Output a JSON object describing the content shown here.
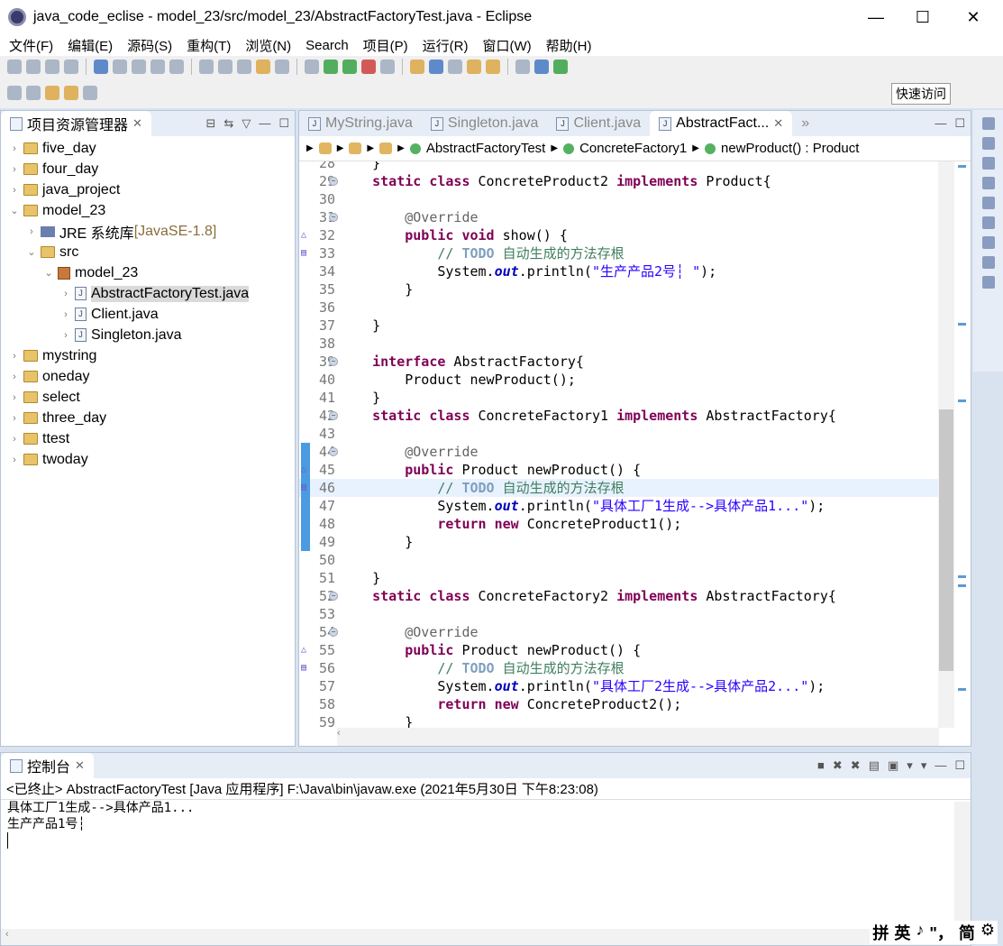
{
  "window": {
    "title": "java_code_eclise - model_23/src/model_23/AbstractFactoryTest.java - Eclipse",
    "minimize": "—",
    "maximize": "☐",
    "close": "✕"
  },
  "menu": [
    "文件(F)",
    "编辑(E)",
    "源码(S)",
    "重构(T)",
    "浏览(N)",
    "Search",
    "项目(P)",
    "运行(R)",
    "窗口(W)",
    "帮助(H)"
  ],
  "quick_access": "快速访问",
  "explorer": {
    "title": "项目资源管理器",
    "items": [
      {
        "label": "five_day",
        "depth": 0,
        "arrow": "›",
        "icon": "folder"
      },
      {
        "label": "four_day",
        "depth": 0,
        "arrow": "›",
        "icon": "folder"
      },
      {
        "label": "java_project",
        "depth": 0,
        "arrow": "›",
        "icon": "folder"
      },
      {
        "label": "model_23",
        "depth": 0,
        "arrow": "⌄",
        "icon": "folder"
      },
      {
        "label": "JRE 系统库",
        "extra": " [JavaSE-1.8]",
        "depth": 1,
        "arrow": "›",
        "icon": "library"
      },
      {
        "label": "src",
        "depth": 1,
        "arrow": "⌄",
        "icon": "folder"
      },
      {
        "label": "model_23",
        "depth": 2,
        "arrow": "⌄",
        "icon": "package"
      },
      {
        "label": "AbstractFactoryTest.java",
        "depth": 3,
        "arrow": "›",
        "icon": "java-file",
        "selected": true
      },
      {
        "label": "Client.java",
        "depth": 3,
        "arrow": "›",
        "icon": "java-file"
      },
      {
        "label": "Singleton.java",
        "depth": 3,
        "arrow": "›",
        "icon": "java-file"
      },
      {
        "label": "mystring",
        "depth": 0,
        "arrow": "›",
        "icon": "folder"
      },
      {
        "label": "oneday",
        "depth": 0,
        "arrow": "›",
        "icon": "folder"
      },
      {
        "label": "select",
        "depth": 0,
        "arrow": "›",
        "icon": "folder"
      },
      {
        "label": "three_day",
        "depth": 0,
        "arrow": "›",
        "icon": "folder"
      },
      {
        "label": "ttest",
        "depth": 0,
        "arrow": "›",
        "icon": "folder"
      },
      {
        "label": "twoday",
        "depth": 0,
        "arrow": "›",
        "icon": "folder"
      }
    ]
  },
  "editor": {
    "tabs": [
      {
        "label": "MyString.java"
      },
      {
        "label": "Singleton.java"
      },
      {
        "label": "Client.java"
      },
      {
        "label": "AbstractFact...",
        "active": true
      }
    ],
    "tabs_overflow": "»",
    "breadcrumb": [
      "AbstractFactoryTest",
      "ConcreteFactory1",
      "newProduct() : Product"
    ],
    "highlight_line": 46,
    "lines": [
      {
        "n": 28,
        "t": [
          [
            "p",
            "    }"
          ]
        ]
      },
      {
        "n": 29,
        "fold": true,
        "t": [
          [
            "p",
            "    "
          ],
          [
            "k",
            "static class"
          ],
          [
            "p",
            " ConcreteProduct2 "
          ],
          [
            "k",
            "implements"
          ],
          [
            "p",
            " Product{"
          ]
        ]
      },
      {
        "n": 30,
        "t": []
      },
      {
        "n": 31,
        "fold": true,
        "t": [
          [
            "p",
            "        "
          ],
          [
            "a",
            "@Override"
          ]
        ]
      },
      {
        "n": 32,
        "marker": "override",
        "t": [
          [
            "p",
            "        "
          ],
          [
            "k",
            "public void"
          ],
          [
            "p",
            " show() {"
          ]
        ]
      },
      {
        "n": 33,
        "marker": "task",
        "t": [
          [
            "p",
            "            "
          ],
          [
            "c",
            "// "
          ],
          [
            "t",
            "TODO"
          ],
          [
            "c",
            " 自动生成的方法存根"
          ]
        ]
      },
      {
        "n": 34,
        "t": [
          [
            "p",
            "            System."
          ],
          [
            "f",
            "out"
          ],
          [
            "p",
            ".println("
          ],
          [
            "s",
            "\"生产产品2号┆ \""
          ],
          [
            "p",
            ");"
          ]
        ]
      },
      {
        "n": 35,
        "t": [
          [
            "p",
            "        }"
          ]
        ]
      },
      {
        "n": 36,
        "t": []
      },
      {
        "n": 37,
        "t": [
          [
            "p",
            "    }"
          ]
        ]
      },
      {
        "n": 38,
        "t": []
      },
      {
        "n": 39,
        "fold": true,
        "t": [
          [
            "p",
            "    "
          ],
          [
            "k",
            "interface"
          ],
          [
            "p",
            " AbstractFactory{"
          ]
        ]
      },
      {
        "n": 40,
        "t": [
          [
            "p",
            "        Product newProduct();"
          ]
        ]
      },
      {
        "n": 41,
        "t": [
          [
            "p",
            "    }"
          ]
        ]
      },
      {
        "n": 42,
        "fold": true,
        "t": [
          [
            "p",
            "    "
          ],
          [
            "k",
            "static class"
          ],
          [
            "p",
            " ConcreteFactory1 "
          ],
          [
            "k",
            "implements"
          ],
          [
            "p",
            " AbstractFactory{"
          ]
        ]
      },
      {
        "n": 43,
        "t": []
      },
      {
        "n": 44,
        "fold": true,
        "bar": true,
        "t": [
          [
            "p",
            "        "
          ],
          [
            "a",
            "@Override"
          ]
        ]
      },
      {
        "n": 45,
        "marker": "override",
        "bar": true,
        "t": [
          [
            "p",
            "        "
          ],
          [
            "k",
            "public"
          ],
          [
            "p",
            " Product newProduct() {"
          ]
        ]
      },
      {
        "n": 46,
        "marker": "task",
        "bar": true,
        "t": [
          [
            "p",
            "            "
          ],
          [
            "c",
            "// "
          ],
          [
            "t",
            "TODO"
          ],
          [
            "c",
            " 自动生成的方法存根"
          ]
        ]
      },
      {
        "n": 47,
        "bar": true,
        "t": [
          [
            "p",
            "            System."
          ],
          [
            "f",
            "out"
          ],
          [
            "p",
            ".println("
          ],
          [
            "s",
            "\"具体工厂1生成-->具体产品1...\""
          ],
          [
            "p",
            ");"
          ]
        ]
      },
      {
        "n": 48,
        "bar": true,
        "t": [
          [
            "p",
            "            "
          ],
          [
            "k",
            "return new"
          ],
          [
            "p",
            " ConcreteProduct1();"
          ]
        ]
      },
      {
        "n": 49,
        "bar": true,
        "t": [
          [
            "p",
            "        }"
          ]
        ]
      },
      {
        "n": 50,
        "t": []
      },
      {
        "n": 51,
        "t": [
          [
            "p",
            "    }"
          ]
        ]
      },
      {
        "n": 52,
        "fold": true,
        "t": [
          [
            "p",
            "    "
          ],
          [
            "k",
            "static class"
          ],
          [
            "p",
            " ConcreteFactory2 "
          ],
          [
            "k",
            "implements"
          ],
          [
            "p",
            " AbstractFactory{"
          ]
        ]
      },
      {
        "n": 53,
        "t": []
      },
      {
        "n": 54,
        "fold": true,
        "t": [
          [
            "p",
            "        "
          ],
          [
            "a",
            "@Override"
          ]
        ]
      },
      {
        "n": 55,
        "marker": "override",
        "t": [
          [
            "p",
            "        "
          ],
          [
            "k",
            "public"
          ],
          [
            "p",
            " Product newProduct() {"
          ]
        ]
      },
      {
        "n": 56,
        "marker": "task",
        "t": [
          [
            "p",
            "            "
          ],
          [
            "c",
            "// "
          ],
          [
            "t",
            "TODO"
          ],
          [
            "c",
            " 自动生成的方法存根"
          ]
        ]
      },
      {
        "n": 57,
        "t": [
          [
            "p",
            "            System."
          ],
          [
            "f",
            "out"
          ],
          [
            "p",
            ".println("
          ],
          [
            "s",
            "\"具体工厂2生成-->具体产品2...\""
          ],
          [
            "p",
            ");"
          ]
        ]
      },
      {
        "n": 58,
        "t": [
          [
            "p",
            "            "
          ],
          [
            "k",
            "return new"
          ],
          [
            "p",
            " ConcreteProduct2();"
          ]
        ]
      },
      {
        "n": 59,
        "t": [
          [
            "p",
            "        }"
          ]
        ]
      }
    ]
  },
  "console": {
    "title": "控制台",
    "status": "<已终止> AbstractFactoryTest [Java 应用程序] F:\\Java\\bin\\javaw.exe  (2021年5月30日 下午8:23:08)",
    "output": [
      "具体工厂1生成-->具体产品1...",
      "生产产品1号┆"
    ]
  },
  "ime": [
    "拼",
    "英",
    "♪",
    "\"，",
    "简",
    "⚙"
  ],
  "colors": {
    "keyword": "#7f0055",
    "string": "#2a00ff",
    "comment": "#3f7f5f",
    "annotation": "#646464",
    "field": "#0000c0",
    "highlight": "#e8f2fe"
  }
}
